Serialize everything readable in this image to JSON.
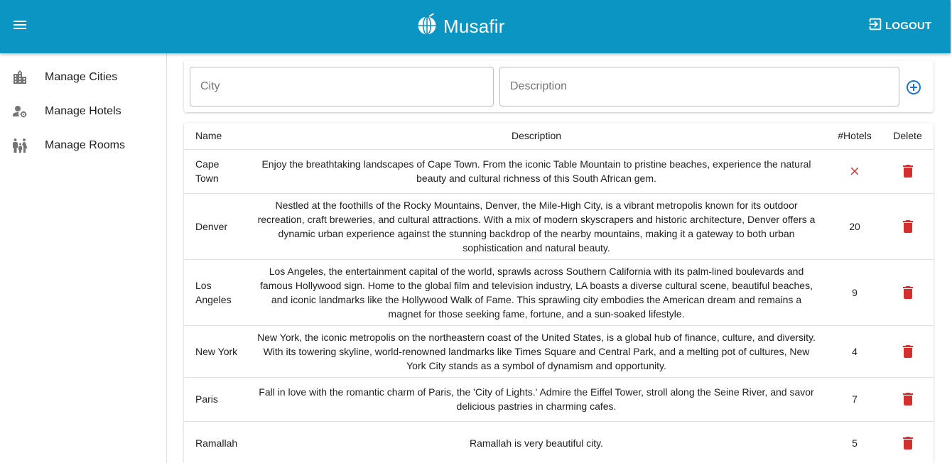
{
  "header": {
    "title": "Musafir",
    "logout_label": "LOGOUT",
    "background_color": "#0b95c2",
    "icons": {
      "menu": "menu-icon",
      "logo": "globe-icon",
      "logout": "logout-icon"
    }
  },
  "sidebar": {
    "items": [
      {
        "label": "Manage Cities",
        "icon": "city-icon"
      },
      {
        "label": "Manage Hotels",
        "icon": "user-settings-icon"
      },
      {
        "label": "Manage Rooms",
        "icon": "family-icon"
      }
    ]
  },
  "form": {
    "city_placeholder": "City",
    "city_value": "",
    "description_placeholder": "Description",
    "description_value": "",
    "add_icon": "add-circle-icon"
  },
  "table": {
    "headers": {
      "name": "Name",
      "description": "Description",
      "hotels": "#Hotels",
      "delete": "Delete"
    },
    "rows": [
      {
        "name": "Cape Town",
        "description": "Enjoy the breathtaking landscapes of Cape Town. From the iconic Table Mountain to pristine beaches, experience the natural beauty and cultural richness of this South African gem.",
        "hotels": ""
      },
      {
        "name": "Denver",
        "description": "Nestled at the foothills of the Rocky Mountains, Denver, the Mile-High City, is a vibrant metropolis known for its outdoor recreation, craft breweries, and cultural attractions. With a mix of modern skyscrapers and historic architecture, Denver offers a dynamic urban experience against the stunning backdrop of the nearby mountains, making it a gateway to both urban sophistication and natural beauty.",
        "hotels": "20"
      },
      {
        "name": "Los Angeles",
        "description": "Los Angeles, the entertainment capital of the world, sprawls across Southern California with its palm-lined boulevards and famous Hollywood sign. Home to the global film and television industry, LA boasts a diverse cultural scene, beautiful beaches, and iconic landmarks like the Hollywood Walk of Fame. This sprawling city embodies the American dream and remains a magnet for those seeking fame, fortune, and a sun-soaked lifestyle.",
        "hotels": "9"
      },
      {
        "name": "New York",
        "description": "New York, the iconic metropolis on the northeastern coast of the United States, is a global hub of finance, culture, and diversity. With its towering skyline, world-renowned landmarks like Times Square and Central Park, and a melting pot of cultures, New York City stands as a symbol of dynamism and opportunity.",
        "hotels": "4"
      },
      {
        "name": "Paris",
        "description": "Fall in love with the romantic charm of Paris, the 'City of Lights.' Admire the Eiffel Tower, stroll along the Seine River, and savor delicious pastries in charming cafes.",
        "hotels": "7"
      },
      {
        "name": "Ramallah",
        "description": "Ramallah is very beautiful city.",
        "hotels": "5"
      }
    ],
    "no_hotels_icon": "close-icon",
    "delete_icon": "trash-icon",
    "no_hotels_color": "#d32f2f",
    "delete_color": "#d32f2f"
  }
}
